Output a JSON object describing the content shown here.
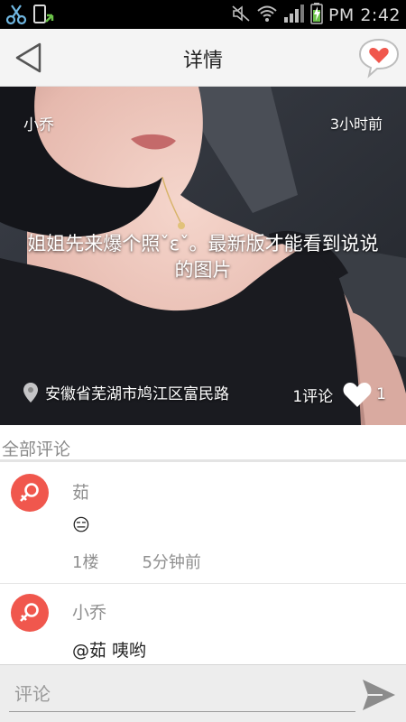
{
  "status_bar": {
    "time": "PM 2:42",
    "icons": [
      "scissors-icon",
      "download-notification-icon",
      "mute-icon",
      "wifi-icon",
      "signal-icon",
      "battery-charging-icon"
    ]
  },
  "header": {
    "title": "详情",
    "back_icon": "back-triangle-icon",
    "like_icon": "heart-bubble-icon"
  },
  "post": {
    "author": "小乔",
    "time": "3小时前",
    "caption": "姐姐先来爆个照ˇεˇ。最新版才能看到说说的图片",
    "location": "安徽省芜湖市鸠江区富民路",
    "comments_label": "1评论",
    "likes": "1"
  },
  "comments_section": {
    "title": "全部评论"
  },
  "comments": [
    {
      "name": "茹",
      "text": "😑",
      "floor": "1楼",
      "time": "5分钟前"
    },
    {
      "name": "小乔",
      "text": "@茹 咦哟"
    }
  ],
  "composer": {
    "placeholder": "评论"
  },
  "colors": {
    "accent": "#f0574d",
    "header_bg": "#f4f4f4",
    "bottom_bg": "#ededed"
  }
}
